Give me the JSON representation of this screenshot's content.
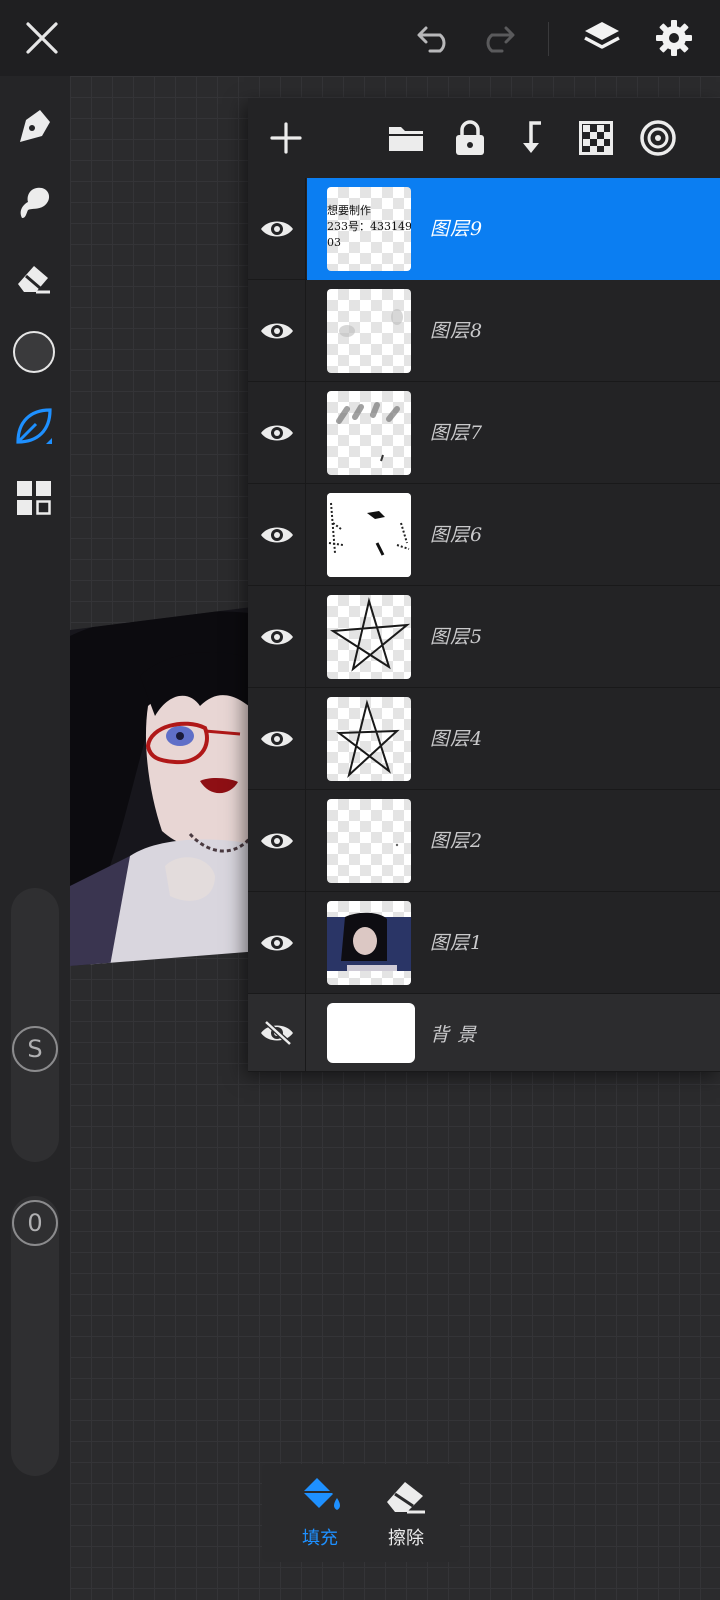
{
  "topbar": {
    "close_icon": "close-icon",
    "undo_icon": "undo-icon",
    "redo_icon": "redo-icon",
    "layers_icon": "layers-icon",
    "settings_icon": "gear-icon"
  },
  "tools": {
    "items": [
      "pen-tool",
      "smudge-tool",
      "eraser-tool",
      "color-picker",
      "leaf-brush",
      "gallery-grid"
    ],
    "active_color": "#3a3a3c",
    "accent": "#1e90ff"
  },
  "sliders": {
    "size_label": "S",
    "opacity_label": "0"
  },
  "layers_toolbar": {
    "add": "plus-icon",
    "folder": "folder-icon",
    "lock": "lock-icon",
    "merge": "merge-down-icon",
    "alpha": "checker-icon",
    "mask": "target-icon"
  },
  "layers": [
    {
      "name": "图层9",
      "selected": true
    },
    {
      "name": "图层8",
      "selected": false
    },
    {
      "name": "图层7",
      "selected": false
    },
    {
      "name": "图层6",
      "selected": false
    },
    {
      "name": "图层5",
      "selected": false
    },
    {
      "name": "图层4",
      "selected": false
    },
    {
      "name": "图层2",
      "selected": false
    },
    {
      "name": "图层1",
      "selected": false
    }
  ],
  "background_layer": {
    "name": "背景",
    "visible": false
  },
  "thumb_text": {
    "line1": "想要制作",
    "line2": "233号：4331493",
    "line3": "03"
  },
  "bottom_popup": {
    "fill_label": "填充",
    "erase_label": "擦除",
    "fill_color": "#1e90ff"
  }
}
